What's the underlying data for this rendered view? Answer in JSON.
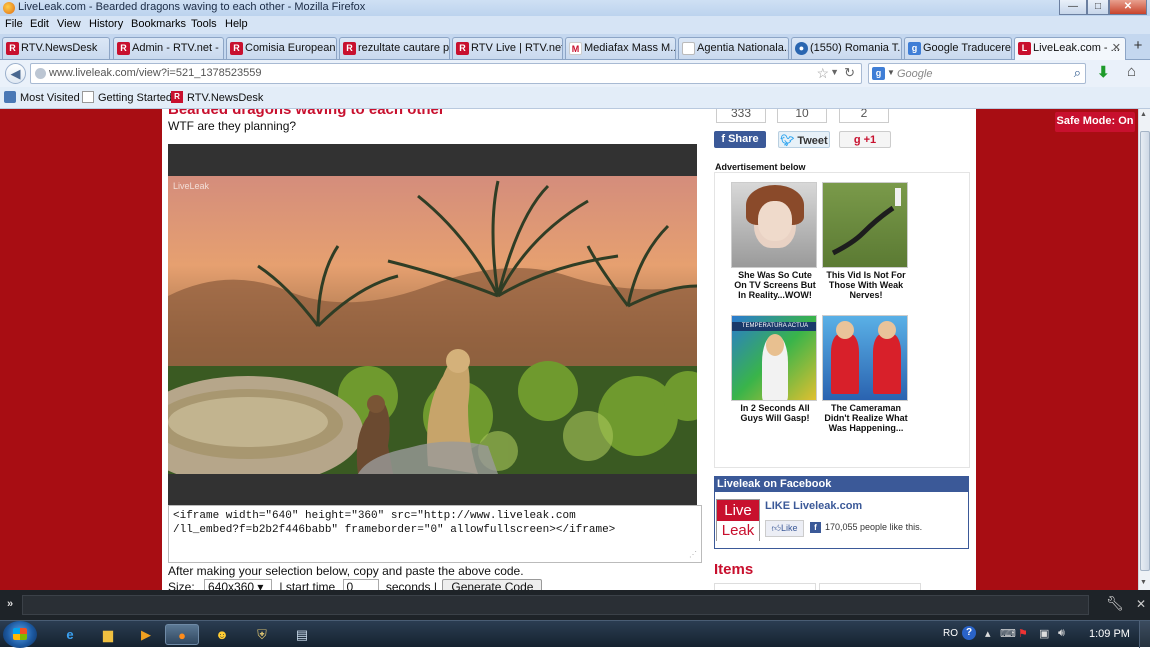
{
  "window": {
    "title": "LiveLeak.com - Bearded dragons waving to each other - Mozilla Firefox",
    "min": "—",
    "max": "□",
    "close": "✕"
  },
  "menu": [
    "File",
    "Edit",
    "View",
    "History",
    "Bookmarks",
    "Tools",
    "Help"
  ],
  "tabs": [
    {
      "label": "RTV.NewsDesk",
      "icon": "rtv-icon"
    },
    {
      "label": "Admin - RTV.net -",
      "icon": "rtv-icon"
    },
    {
      "label": "Comisia European...",
      "icon": "rtv-icon"
    },
    {
      "label": "rezultate cautare p...",
      "icon": "rtv-icon"
    },
    {
      "label": "RTV Live | RTV.net...",
      "icon": "rtv-icon"
    },
    {
      "label": "Mediafax Mass M...",
      "icon": "mediafax-icon"
    },
    {
      "label": "Agentia Nationala...",
      "icon": "blank-page-icon"
    },
    {
      "label": "(1550) Romania T...",
      "icon": "globe-icon"
    },
    {
      "label": "Google Traducere",
      "icon": "google-icon"
    },
    {
      "label": "LiveLeak.com - ...",
      "icon": "liveleak-icon",
      "active": true
    }
  ],
  "new_tab": "+",
  "nav": {
    "url": "www.liveleak.com/view?i=521_1378523559",
    "search_placeholder": "Google"
  },
  "bookmarks": [
    "Most Visited",
    "Getting Started",
    "RTV.NewsDesk"
  ],
  "page": {
    "video_title": "Bearded dragons waving to each other",
    "video_subtitle": "WTF are they planning?",
    "watermark": "LiveLeak",
    "embed_code": "<iframe width=\"640\" height=\"360\" src=\"http://www.liveleak.com\n/ll_embed?f=b2b2f446babb\" frameborder=\"0\" allowfullscreen></iframe>",
    "embed_note": "After making your selection below, copy and paste the above code.",
    "size_label": "Size:",
    "size_value": "640x360",
    "start_label": "| start time",
    "start_value": "0",
    "seconds_label": "seconds |",
    "generate_btn": "Generate Code",
    "safe_mode": "Safe Mode: On"
  },
  "sidebar": {
    "counts": [
      "333",
      "10",
      "2"
    ],
    "share": "Share",
    "tweet": "Tweet",
    "plus": "+1",
    "advert_label": "Advertisement below",
    "ads": [
      {
        "caption": "She Was So Cute On TV Screens But In Reality...WOW!"
      },
      {
        "caption": "This Vid Is Not For Those With Weak Nerves!"
      },
      {
        "caption": "In 2 Seconds All Guys Will Gasp!"
      },
      {
        "caption": "The Cameraman Didn't Realize What Was Happening..."
      }
    ],
    "ad3_overlay": "TEMPERATURA ACTUA",
    "fb_header": "Liveleak on Facebook",
    "fb_logo_top": "Live",
    "fb_logo_bottom": "Leak",
    "fb_like_title": "LIKE Liveleak.com",
    "fb_like_btn": "Like",
    "fb_count": "170,055 people like this.",
    "items_heading": "Items"
  },
  "addon_bar": {
    "chevron": "»"
  },
  "taskbar": {
    "lang": "RO",
    "time": "1:09 PM"
  },
  "colors": {
    "brand_red": "#c8102e",
    "page_bg": "#a80d13",
    "facebook_blue": "#3b5998"
  }
}
